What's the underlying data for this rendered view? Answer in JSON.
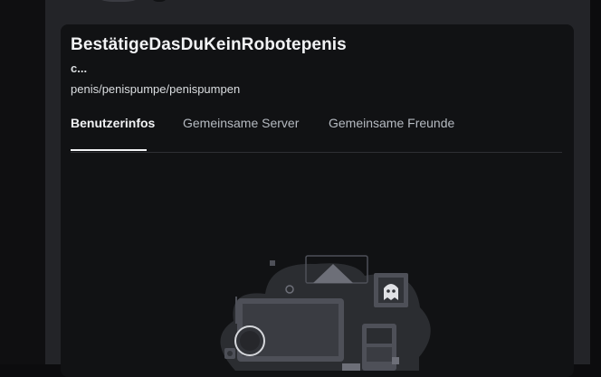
{
  "profile": {
    "display_name": "BestätigeDasDuKeinRobotepenis",
    "username": "c...",
    "pronouns": "penis/penispumpe/penispumpen"
  },
  "tabs": [
    {
      "label": "Benutzerinfos",
      "active": true
    },
    {
      "label": "Gemeinsame Server",
      "active": false
    },
    {
      "label": "Gemeinsame Freunde",
      "active": false
    }
  ],
  "colors": {
    "background": "#0c0c0e",
    "modal": "#232428",
    "card": "#111214",
    "text_primary": "#f2f3f5",
    "text_secondary": "#b5bac1"
  },
  "illustration": {
    "icon": "empty-state-devices-illustration"
  }
}
